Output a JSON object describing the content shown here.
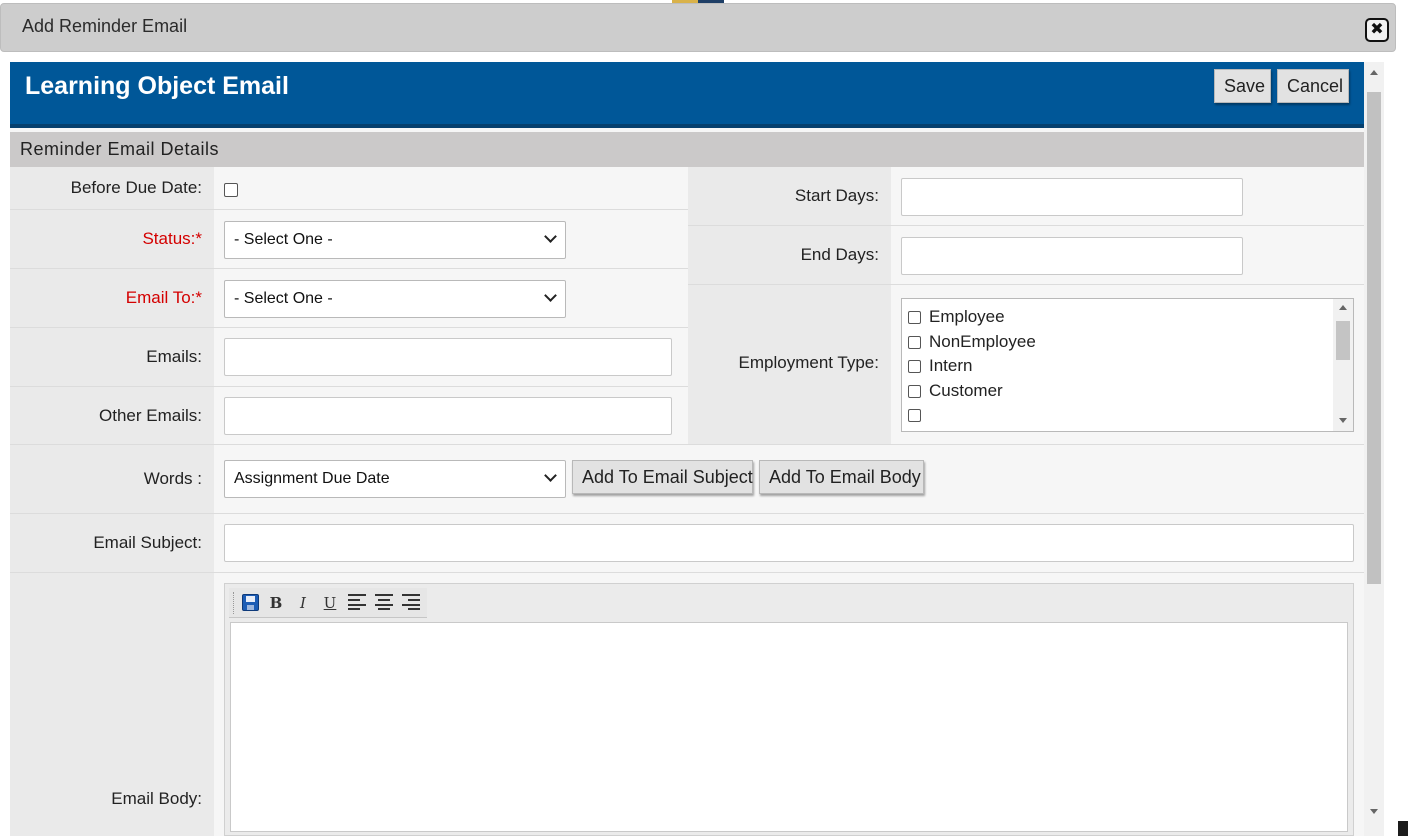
{
  "dialog": {
    "title": "Add Reminder Email",
    "close_icon": "close-icon"
  },
  "header": {
    "title": "Learning Object Email",
    "save_label": "Save",
    "cancel_label": "Cancel"
  },
  "section": {
    "title": "Reminder Email Details"
  },
  "form": {
    "before_due_date_label": "Before Due Date:",
    "before_due_date_checked": false,
    "status_label": "Status:",
    "status_required_mark": "*",
    "status_value": "- Select One -",
    "email_to_label": "Email To:",
    "email_to_required_mark": "*",
    "email_to_value": "- Select One -",
    "emails_label": "Emails:",
    "emails_value": "",
    "other_emails_label": "Other Emails:",
    "other_emails_value": "",
    "start_days_label": "Start Days:",
    "start_days_value": "",
    "end_days_label": "End Days:",
    "end_days_value": "",
    "employment_type_label": "Employment Type:",
    "employment_types": [
      {
        "label": "Employee",
        "checked": false
      },
      {
        "label": "NonEmployee",
        "checked": false
      },
      {
        "label": "Intern",
        "checked": false
      },
      {
        "label": "Customer",
        "checked": false
      },
      {
        "label": "",
        "checked": false
      }
    ],
    "words_label": "Words :",
    "words_value": "Assignment Due Date",
    "add_to_subject_label": "Add To Email Subject",
    "add_to_body_label": "Add To Email Body",
    "email_subject_label": "Email Subject:",
    "email_subject_value": "",
    "email_body_label": "Email Body:",
    "email_body_value": ""
  },
  "editor_toolbar": {
    "bold": "B",
    "italic": "I",
    "underline": "U",
    "icons": [
      "save-icon",
      "bold-icon",
      "italic-icon",
      "underline-icon",
      "align-left-icon",
      "align-center-icon",
      "align-right-icon"
    ]
  },
  "colors": {
    "banner": "#005798",
    "required": "#d40000",
    "section_header": "#cbc9c9"
  }
}
